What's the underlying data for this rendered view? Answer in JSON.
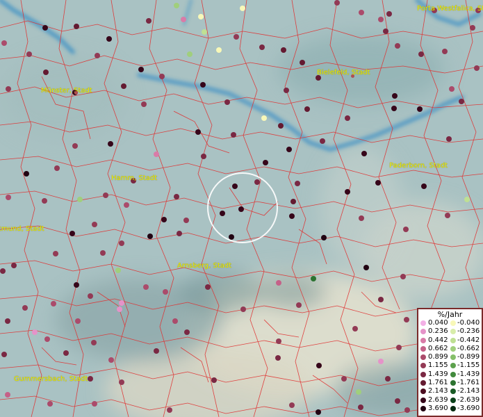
{
  "legend": {
    "title": "%/Jahr",
    "positive": [
      {
        "value": "0.040",
        "color": "#f3b0e6"
      },
      {
        "value": "0.236",
        "color": "#e593c9"
      },
      {
        "value": "0.442",
        "color": "#d97ba8"
      },
      {
        "value": "0.662",
        "color": "#c56188"
      },
      {
        "value": "0.899",
        "color": "#ab4b6b"
      },
      {
        "value": "1.155",
        "color": "#933a55"
      },
      {
        "value": "1.439",
        "color": "#7a2843"
      },
      {
        "value": "1.761",
        "color": "#641a31"
      },
      {
        "value": "2.143",
        "color": "#4c0d20"
      },
      {
        "value": "2.639",
        "color": "#36061a"
      },
      {
        "value": "3.690",
        "color": "#210312"
      }
    ],
    "negative": [
      {
        "value": "-0.040",
        "color": "#f8f8b8"
      },
      {
        "value": "-0.236",
        "color": "#d8edaa"
      },
      {
        "value": "-0.442",
        "color": "#bfe093"
      },
      {
        "value": "-0.662",
        "color": "#a0cf7c"
      },
      {
        "value": "-0.899",
        "color": "#85bf69"
      },
      {
        "value": "-1.155",
        "color": "#5da14d"
      },
      {
        "value": "-1.439",
        "color": "#428a3d"
      },
      {
        "value": "-1.761",
        "color": "#2c7330"
      },
      {
        "value": "-2.143",
        "color": "#195b25"
      },
      {
        "value": "-2.639",
        "color": "#0b421a"
      },
      {
        "value": "-3.690",
        "color": "#052a10"
      }
    ]
  },
  "cities": [
    {
      "name": "Porta Westfalica, Stadt"
    },
    {
      "name": "Bielefeld, Stadt"
    },
    {
      "name": "Münster, Stadt"
    },
    {
      "name": "Paderborn, Stadt"
    },
    {
      "name": "Hamm, Stadt"
    },
    {
      "name": "Dortmund, Stadt"
    },
    {
      "name": "Arnsberg, Stadt"
    },
    {
      "name": "Gummersbach, Stadt"
    }
  ],
  "colors": {
    "border": "#e03030",
    "river": "#3a8fc4",
    "label": "#f2f200",
    "selection_ring": "#ffffff"
  }
}
